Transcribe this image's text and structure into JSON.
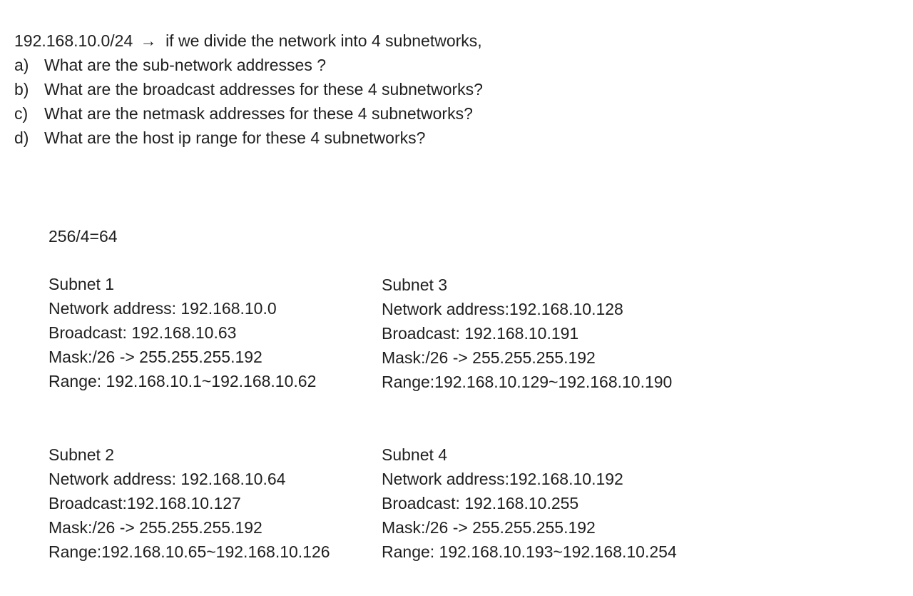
{
  "question": {
    "network": "192.168.10.0/24",
    "arrow": "→",
    "prompt": "if we divide the network into 4 subnetworks,",
    "items": [
      {
        "letter": "a)",
        "text": "What are the sub-network addresses ?"
      },
      {
        "letter": "b)",
        "text": "What are the broadcast addresses for these 4 subnetworks?"
      },
      {
        "letter": "c)",
        "text": "What are the netmask addresses for these 4 subnetworks?"
      },
      {
        "letter": "d)",
        "text": "What are the host ip range for these 4 subnetworks?"
      }
    ]
  },
  "calculation": "256/4=64",
  "subnets": {
    "s1": {
      "title": "Subnet 1",
      "network": "Network  address: 192.168.10.0",
      "broadcast": "Broadcast: 192.168.10.63",
      "mask": "Mask:/26 -> 255.255.255.192",
      "range": "Range: 192.168.10.1~192.168.10.62"
    },
    "s2": {
      "title": "Subnet 2",
      "network": "Network address: 192.168.10.64",
      "broadcast": "Broadcast:192.168.10.127",
      "mask": "Mask:/26 -> 255.255.255.192",
      "range": "Range:192.168.10.65~192.168.10.126"
    },
    "s3": {
      "title": "Subnet 3",
      "network": "Network address:192.168.10.128",
      "broadcast": "Broadcast: 192.168.10.191",
      "mask": "Mask:/26 -> 255.255.255.192",
      "range": "Range:192.168.10.129~192.168.10.190"
    },
    "s4": {
      "title": "Subnet 4",
      "network": "Network address:192.168.10.192",
      "broadcast": "Broadcast: 192.168.10.255",
      "mask": "Mask:/26 -> 255.255.255.192",
      "range": "Range: 192.168.10.193~192.168.10.254"
    }
  }
}
